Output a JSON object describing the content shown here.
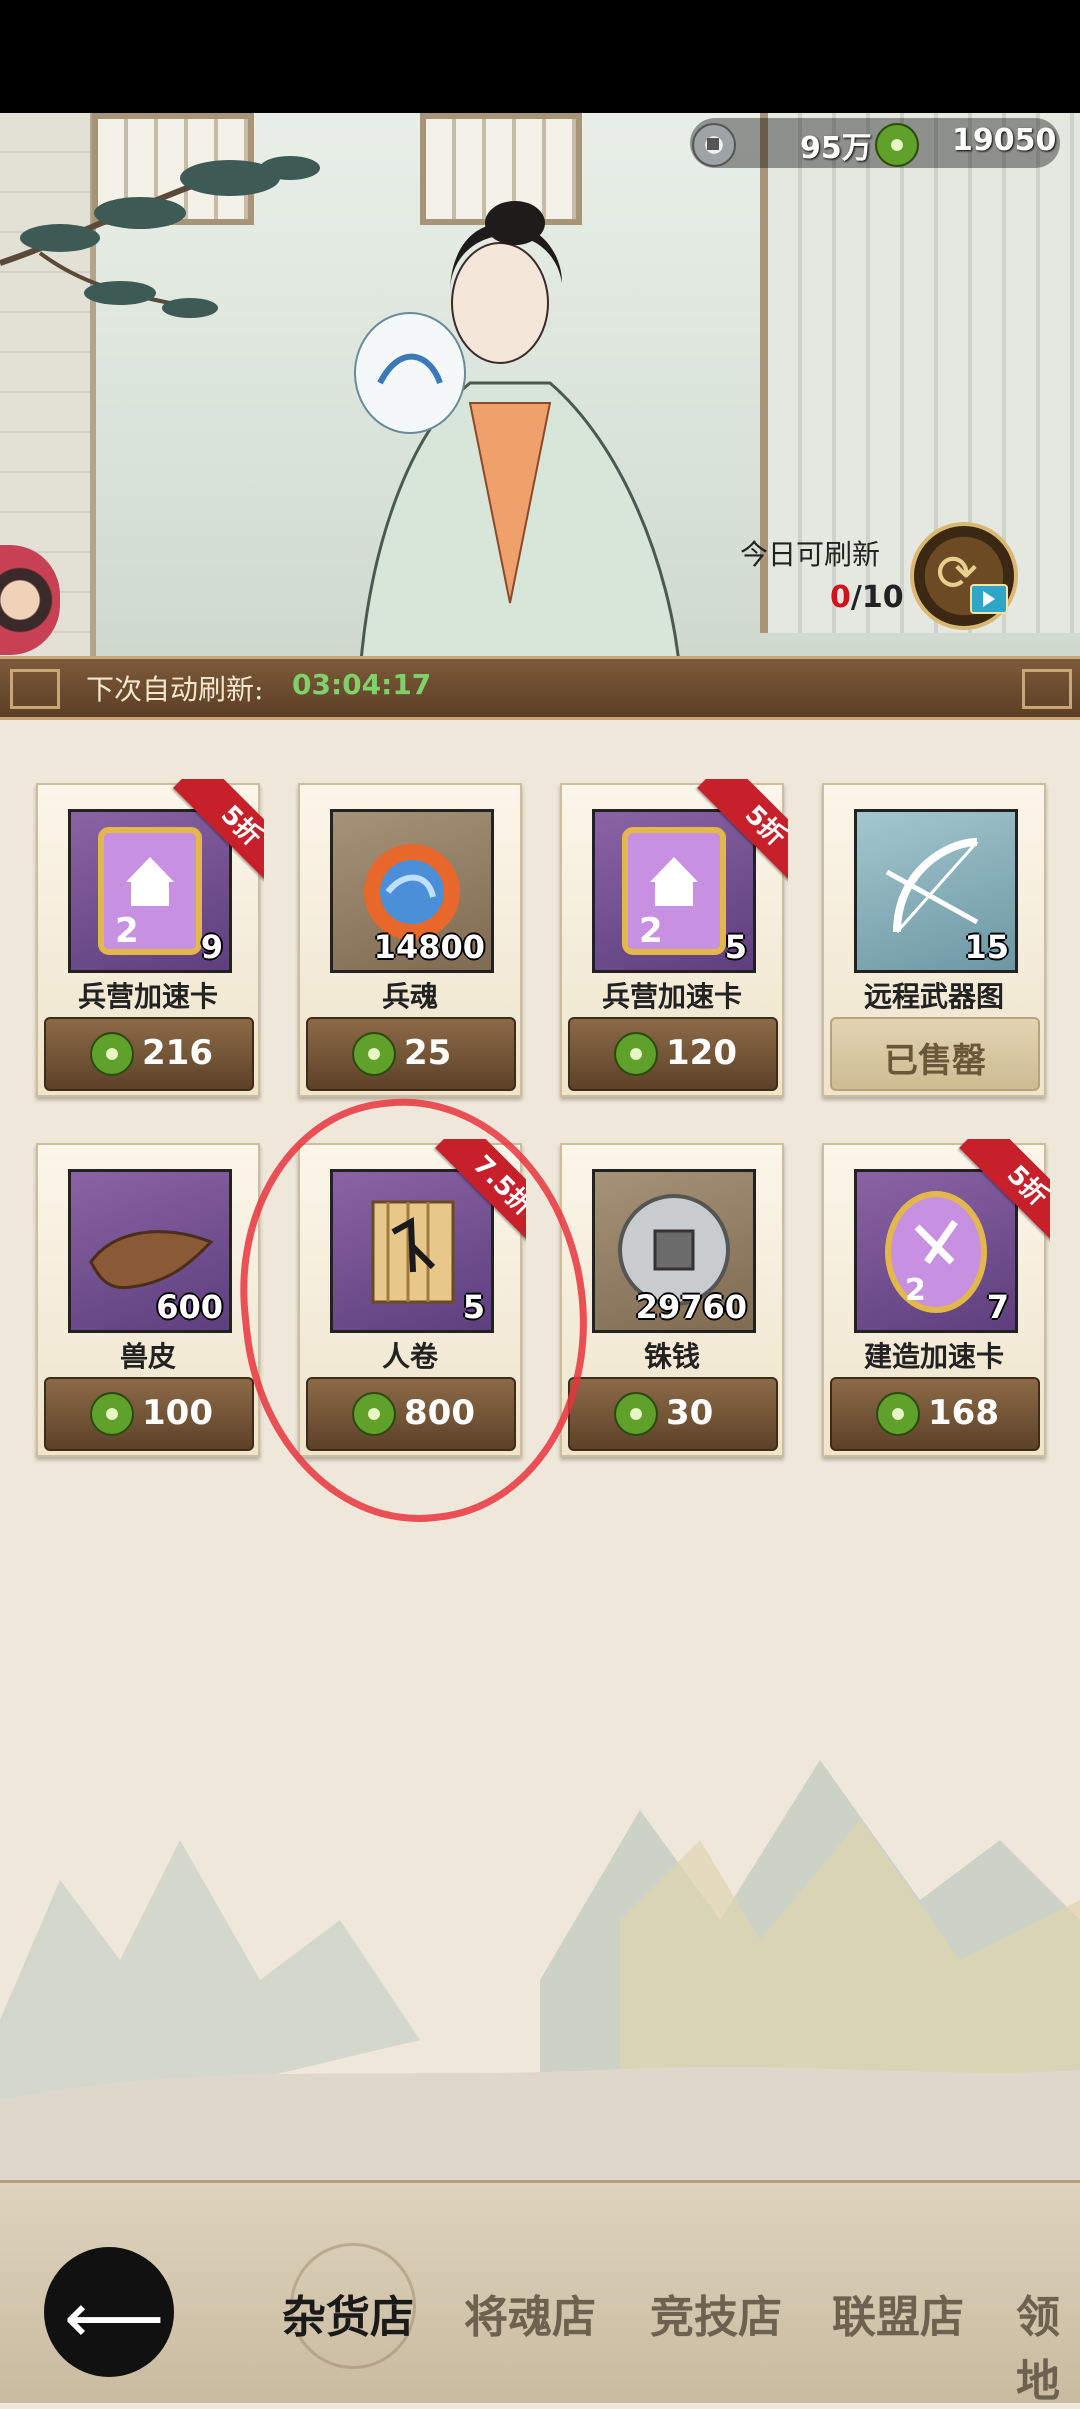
{
  "currency": {
    "copper_amount": "95万",
    "jade_amount": "19050"
  },
  "refresh": {
    "label": "今日可刷新",
    "used": "0",
    "total": "/10"
  },
  "auto_refresh": {
    "label": "下次自动刷新:",
    "time": "03:04:17"
  },
  "items": [
    {
      "name": "兵营加速卡",
      "qty": "9",
      "price": "216",
      "discount": "5折",
      "sold": false
    },
    {
      "name": "兵魂",
      "qty": "14800",
      "price": "25",
      "discount": "",
      "sold": false
    },
    {
      "name": "兵营加速卡",
      "qty": "5",
      "price": "120",
      "discount": "5折",
      "sold": false
    },
    {
      "name": "远程武器图",
      "qty": "15",
      "price": "已售罄",
      "discount": "",
      "sold": true
    },
    {
      "name": "兽皮",
      "qty": "600",
      "price": "100",
      "discount": "",
      "sold": false
    },
    {
      "name": "人卷",
      "qty": "5",
      "price": "800",
      "discount": "7.5折",
      "sold": false
    },
    {
      "name": "铢钱",
      "qty": "29760",
      "price": "30",
      "discount": "",
      "sold": false
    },
    {
      "name": "建造加速卡",
      "qty": "7",
      "price": "168",
      "discount": "5折",
      "sold": false
    }
  ],
  "tabs": [
    "杂货店",
    "将魂店",
    "竞技店",
    "联盟店",
    "领地"
  ],
  "active_tab": "杂货店",
  "icons": {
    "back": "back-arrow-icon",
    "refresh": "refresh-icon",
    "video": "video-ad-icon",
    "copper": "copper-coin-icon",
    "jade": "jade-coin-icon"
  },
  "colors": {
    "discount_ribbon": "#c8202a",
    "timer": "#7fd26b",
    "refresh_used": "#d0121b",
    "price_button": "#6f5235"
  }
}
